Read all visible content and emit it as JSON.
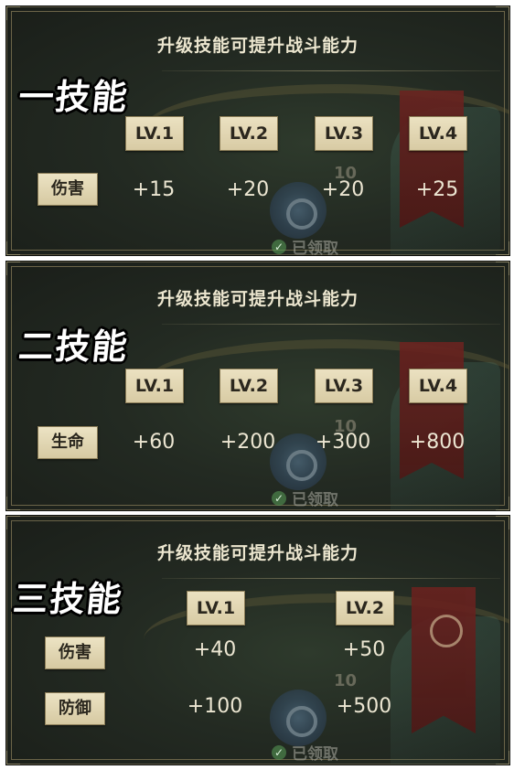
{
  "panels": [
    {
      "title": "升级技能可提升战斗能力",
      "skill_name": "一技能",
      "levels": [
        "LV.1",
        "LV.2",
        "LV.3",
        "LV.4"
      ],
      "stats": [
        {
          "label": "伤害",
          "values": [
            "+15",
            "+20",
            "+20",
            "+25"
          ]
        }
      ],
      "bg_ten": "10",
      "claimed": "已领取"
    },
    {
      "title": "升级技能可提升战斗能力",
      "skill_name": "二技能",
      "levels": [
        "LV.1",
        "LV.2",
        "LV.3",
        "LV.4"
      ],
      "stats": [
        {
          "label": "生命",
          "values": [
            "+60",
            "+200",
            "+300",
            "+800"
          ]
        }
      ],
      "bg_ten": "10",
      "claimed": "已领取"
    },
    {
      "title": "升级技能可提升战斗能力",
      "skill_name": "三技能",
      "levels": [
        "LV.1",
        "LV.2"
      ],
      "stats": [
        {
          "label": "伤害",
          "values": [
            "+40",
            "+50"
          ]
        },
        {
          "label": "防御",
          "values": [
            "+100",
            "+500"
          ]
        }
      ],
      "bg_ten": "10",
      "claimed": "已领取"
    }
  ],
  "icons": {
    "check": "check-circle-icon",
    "shield": "shield-emblem-icon",
    "banner": "red-banner-icon"
  },
  "colors": {
    "panel_bg": "#232a22",
    "label_bg": "#e4d9b6",
    "banner_red": "#6a2320",
    "text_light": "#ece6cf"
  }
}
